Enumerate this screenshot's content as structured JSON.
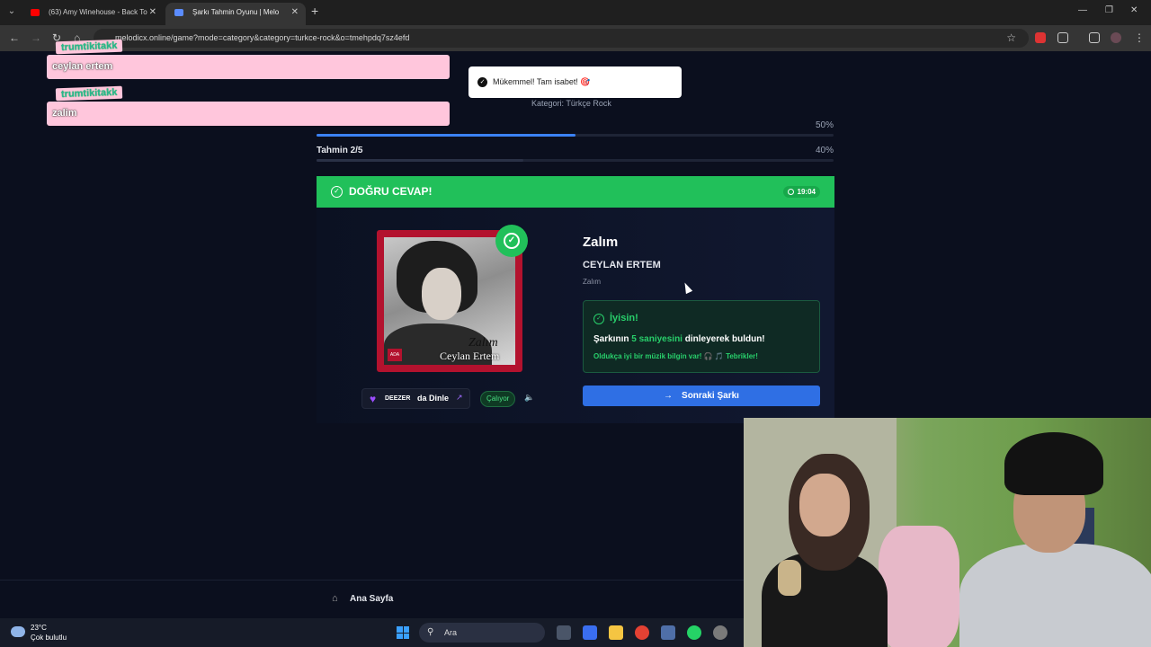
{
  "browser": {
    "tabs": [
      {
        "title": "(63) Amy Winehouse - Back To",
        "close": "✕",
        "favicon_color": "#ff0000"
      },
      {
        "title": "Şarkı Tahmin Oyunu | Melo",
        "close": "✕",
        "favicon_color": "#5b8cff"
      }
    ],
    "new_tab": "+",
    "url": "melodicx.online/game?mode=category&category=turkce-rock&o=tmehpdq7sz4efd"
  },
  "chat": [
    {
      "user": "trumtikitakk",
      "message": "ceylan ertem"
    },
    {
      "user": "trumtikitakk",
      "message": "zalim"
    }
  ],
  "toast": {
    "text": "Mükemmel! Tam isabet! 🎯"
  },
  "game": {
    "category": "Kategori: Türkçe Rock",
    "progress": [
      {
        "label": "",
        "value": "50%",
        "fraction": 0.5,
        "color": "#3b82f6"
      },
      {
        "label": "Tahmin 2/5",
        "value": "40%",
        "fraction": 0.4,
        "color": "#2a3146"
      }
    ],
    "banner": {
      "title": "DOĞRU CEVAP!",
      "time": "19:04"
    },
    "song": {
      "title": "Zalım",
      "artist": "CEYLAN ERTEM",
      "album": "Zalım",
      "cover_title": "Zalım",
      "cover_artist": "Ceylan Ertem",
      "cover_logo": "ADA"
    },
    "deezer": {
      "brand": "DEEZER",
      "label": "da Dinle"
    },
    "playing": "Çalıyor",
    "result": {
      "heading": "İyisin!",
      "line_prefix": "Şarkının ",
      "line_highlight": "5 saniyesini",
      "line_suffix": " dinleyerek buldun!",
      "praise": "Oldukça iyi bir müzik bilgin var! 🎧 🎵 Tebrikler!"
    },
    "next_button": "Sonraki Şarkı",
    "home": "Ana Sayfa"
  },
  "taskbar": {
    "temperature": "23°C",
    "condition": "Çok bulutlu",
    "search_placeholder": "Ara"
  }
}
